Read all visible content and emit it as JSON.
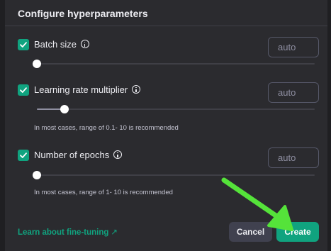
{
  "dialog": {
    "title": "Configure hyperparameters",
    "learn_link": "Learn about fine-tuning",
    "learn_link_icon": "arrow-up-right-icon",
    "cancel_label": "Cancel",
    "create_label": "Create"
  },
  "params": {
    "batch_size": {
      "label": "Batch size",
      "checked": true,
      "placeholder": "auto",
      "slider_fraction": 0.0,
      "hint": ""
    },
    "lr_multiplier": {
      "label": "Learning rate multiplier",
      "checked": true,
      "placeholder": "auto",
      "slider_fraction": 0.1,
      "hint": "In most cases, range of 0.1- 10 is recommended"
    },
    "epochs": {
      "label": "Number of epochs",
      "checked": true,
      "placeholder": "auto",
      "slider_fraction": 0.0,
      "hint": "In most cases, range of 1- 10 is recommended"
    }
  },
  "colors": {
    "accent": "#10a37f",
    "annotation_arrow": "#55e33a",
    "background": "#2b2b2f"
  }
}
